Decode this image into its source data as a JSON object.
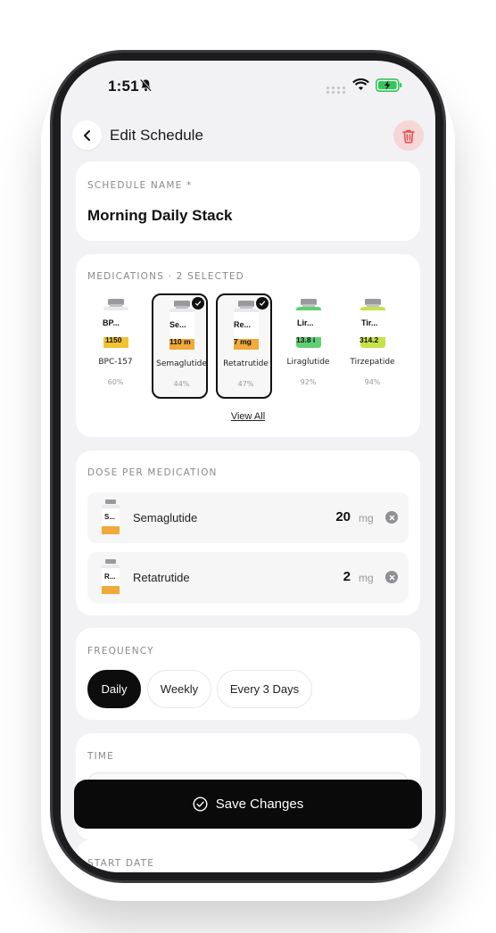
{
  "status_bar": {
    "time": "1:51"
  },
  "header": {
    "title": "Edit Schedule"
  },
  "schedule": {
    "label": "SCHEDULE NAME *",
    "name": "Morning Daily Stack"
  },
  "medications": {
    "label": "MEDICATIONS · 2 SELECTED",
    "items": [
      {
        "name": "BPC-157",
        "vial_label": "BP...",
        "vial_amount": "1150",
        "percent": "60%",
        "selected": false,
        "color": "#f2c232"
      },
      {
        "name": "Semaglutide",
        "vial_label": "Se...",
        "vial_amount": "110 m",
        "percent": "44%",
        "selected": true,
        "color": "#f0a93a"
      },
      {
        "name": "Retatrutide",
        "vial_label": "Re...",
        "vial_amount": "7 mg",
        "percent": "47%",
        "selected": true,
        "color": "#f0a93a"
      },
      {
        "name": "Liraglutide",
        "vial_label": "Lir...",
        "vial_amount": "13.8 i",
        "percent": "92%",
        "selected": false,
        "color": "#5fcf73"
      },
      {
        "name": "Tirzepatide",
        "vial_label": "Tir...",
        "vial_amount": "314.2",
        "percent": "94%",
        "selected": false,
        "color": "#c6e24a"
      }
    ],
    "view_all": "View All"
  },
  "dose": {
    "label": "DOSE PER MEDICATION",
    "rows": [
      {
        "vial_label": "S...",
        "name": "Semaglutide",
        "value": "20",
        "unit": "mg"
      },
      {
        "vial_label": "R...",
        "name": "Retatrutide",
        "value": "2",
        "unit": "mg"
      }
    ]
  },
  "frequency": {
    "label": "FREQUENCY",
    "options": [
      "Daily",
      "Weekly",
      "Every 3 Days"
    ],
    "selected": "Daily"
  },
  "time_section": {
    "label": "TIME"
  },
  "save_button": {
    "label": "Save Changes"
  },
  "start_date": {
    "label": "START DATE"
  },
  "colors": {
    "accent": "#0a0a0a",
    "danger_bg": "#f6d6d6",
    "danger_icon": "#e05050",
    "battery": "#32c759"
  }
}
